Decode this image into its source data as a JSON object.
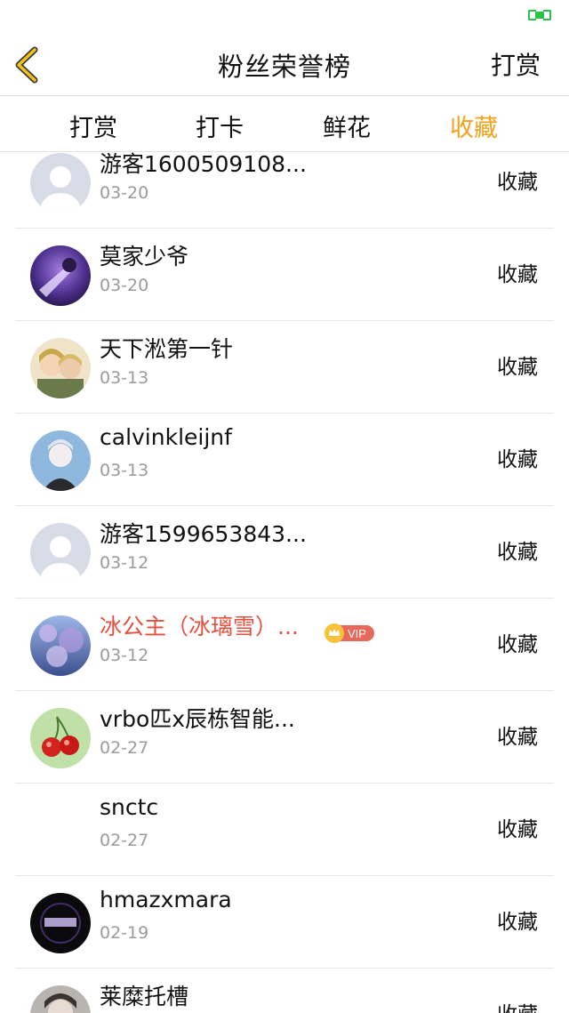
{
  "nav": {
    "title": "粉丝荣誉榜",
    "right_action": "打赏"
  },
  "tabs": [
    "打赏",
    "打卡",
    "鲜花",
    "收藏"
  ],
  "active_tab_color": "#f2a21b",
  "vip_color": "#e4503e",
  "vip_badge_label": "VIP",
  "rows": [
    {
      "name": "游客1600509108...",
      "date": "03-20",
      "action": "收藏",
      "avatar": "default"
    },
    {
      "name": "莫家少爷",
      "date": "03-20",
      "action": "收藏",
      "avatar": "purple-anime"
    },
    {
      "name": "天下淞第一针",
      "date": "03-13",
      "action": "收藏",
      "avatar": "couple-photo"
    },
    {
      "name": "calvinkleijnf",
      "date": "03-13",
      "action": "收藏",
      "avatar": "blue-portrait"
    },
    {
      "name": "游客1599653843...",
      "date": "03-12",
      "action": "收藏",
      "avatar": "default"
    },
    {
      "name": "冰公主（冰璃雪）...",
      "date": "03-12",
      "action": "收藏",
      "avatar": "purple-flowers",
      "vip": true
    },
    {
      "name": "vrbo匹x辰栋智能...",
      "date": "02-27",
      "action": "收藏",
      "avatar": "cherries"
    },
    {
      "name": "snctc",
      "date": "02-27",
      "action": "收藏",
      "avatar": "none"
    },
    {
      "name": "hmazxmara",
      "date": "02-19",
      "action": "收藏",
      "avatar": "dark-logo"
    },
    {
      "name": "莱糜托槽",
      "date": "",
      "action": "收藏",
      "avatar": "gray-portrait"
    }
  ]
}
